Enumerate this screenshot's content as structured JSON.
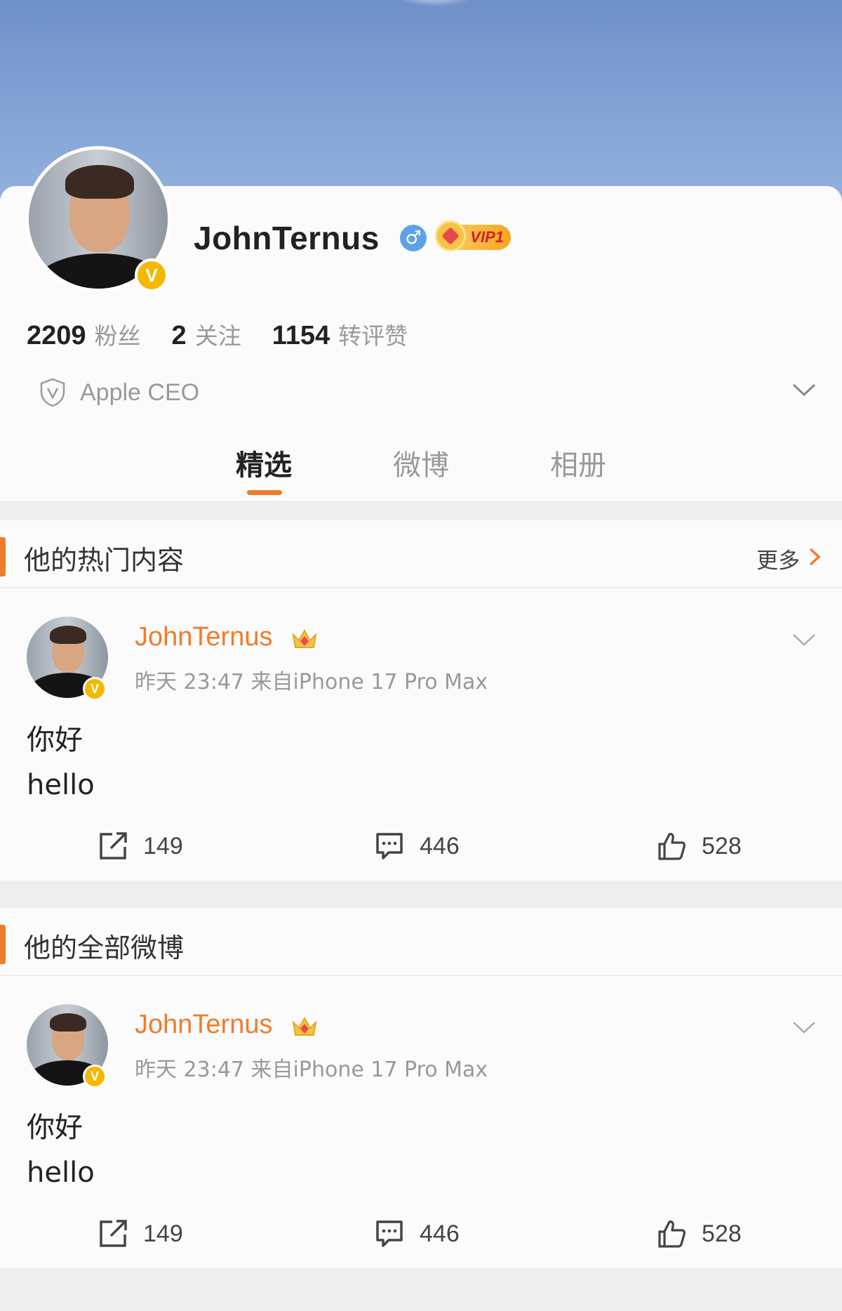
{
  "profile": {
    "username": "JohnTernus",
    "vip_label": "VIP1",
    "verified_mark": "V",
    "gender_symbol": "♂",
    "stats": [
      {
        "num": "2209",
        "label": "粉丝"
      },
      {
        "num": "2",
        "label": "关注"
      },
      {
        "num": "1154",
        "label": "转评赞"
      }
    ],
    "certification": "Apple CEO"
  },
  "tabs": [
    {
      "label": "精选",
      "active": true
    },
    {
      "label": "微博",
      "active": false
    },
    {
      "label": "相册",
      "active": false
    }
  ],
  "hot_section": {
    "title": "他的热门内容",
    "more_label": "更多"
  },
  "all_section": {
    "title": "他的全部微博"
  },
  "posts": [
    {
      "author": "JohnTernus",
      "meta": "昨天 23:47  来自iPhone 17 Pro Max",
      "line1": "你好",
      "line2": "hello",
      "reposts": "149",
      "comments": "446",
      "likes": "528"
    },
    {
      "author": "JohnTernus",
      "meta": "昨天 23:47  来自iPhone 17 Pro Max",
      "line1": "你好",
      "line2": "hello",
      "reposts": "149",
      "comments": "446",
      "likes": "528"
    }
  ],
  "colors": {
    "accent": "#f07c2a",
    "verified": "#f5b800",
    "gender": "#5ea2e6",
    "muted_text": "#999999"
  },
  "icons": [
    "shield-icon",
    "chevron-down-icon",
    "chevron-right-icon",
    "repost-icon",
    "comment-icon",
    "like-icon",
    "crown-icon",
    "verified-icon",
    "male-icon"
  ]
}
